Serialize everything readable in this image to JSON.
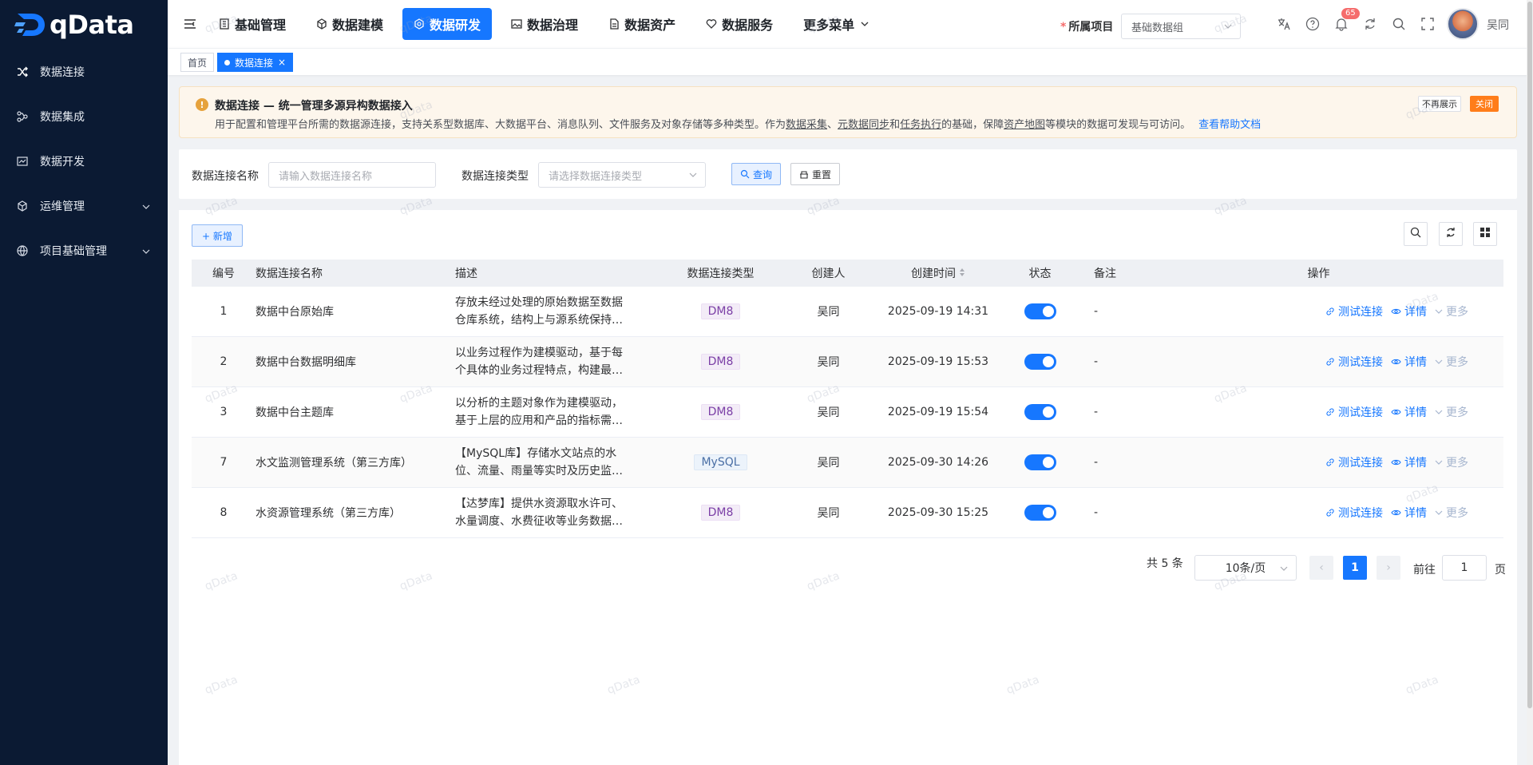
{
  "brand": {
    "name": "qData"
  },
  "sidebar": {
    "items": [
      {
        "label": "数据连接",
        "icon": "shuffle-icon",
        "expandable": false
      },
      {
        "label": "数据集成",
        "icon": "nodes-icon",
        "expandable": false
      },
      {
        "label": "数据开发",
        "icon": "chart-icon",
        "expandable": false
      },
      {
        "label": "运维管理",
        "icon": "cube-icon",
        "expandable": true
      },
      {
        "label": "项目基础管理",
        "icon": "globe-icon",
        "expandable": true
      }
    ]
  },
  "topnav": {
    "items": [
      {
        "label": "基础管理",
        "icon": "building-icon",
        "active": false
      },
      {
        "label": "数据建模",
        "icon": "box-icon",
        "active": false
      },
      {
        "label": "数据研发",
        "icon": "hexagon-icon",
        "active": true
      },
      {
        "label": "数据治理",
        "icon": "image-icon",
        "active": false
      },
      {
        "label": "数据资产",
        "icon": "doc-icon",
        "active": false
      },
      {
        "label": "数据服务",
        "icon": "heart-icon",
        "active": false
      },
      {
        "label": "更多菜单",
        "icon": "chevron-down-icon",
        "active": false
      }
    ],
    "project_label": "所属项目",
    "project_required_mark": "*",
    "project_value": "基础数据组",
    "notification_count": "65",
    "user_name": "吴同"
  },
  "tabs": [
    {
      "label": "首页",
      "active": false
    },
    {
      "label": "数据连接",
      "active": true
    }
  ],
  "notice": {
    "title": "数据连接 — 统一管理多源异构数据接入",
    "desc_part1": "用于配置和管理平台所需的数据源连接，支持关系型数据库、大数据平台、消息队列、文件服务及对象存储等多种类型。作为",
    "link1": "数据采集",
    "sep1": "、",
    "link2": "元数据同步",
    "sep2": "和",
    "link3": "任务执行",
    "desc_part2": "的基础，保障",
    "link4": "资产地图",
    "desc_part3": "等模块的数据可发现与可访问。",
    "help_link": "查看帮助文档",
    "hide_label": "不再展示",
    "close_label": "关闭"
  },
  "search": {
    "name_label": "数据连接名称",
    "name_placeholder": "请输入数据连接名称",
    "type_label": "数据连接类型",
    "type_placeholder": "请选择数据连接类型",
    "query_label": "查询",
    "reset_label": "重置"
  },
  "toolbar": {
    "add_label": "+ 新增"
  },
  "table": {
    "headers": {
      "no": "编号",
      "name": "数据连接名称",
      "desc": "描述",
      "type": "数据连接类型",
      "creator": "创建人",
      "time": "创建时间",
      "status": "状态",
      "note": "备注",
      "ops": "操作"
    },
    "op_test": "测试连接",
    "op_detail": "详情",
    "op_more": "更多",
    "rows": [
      {
        "no": "1",
        "name": "数据中台原始库",
        "desc": "存放未经过处理的原始数据至数据仓库系统，结构上与源系统保持一致",
        "type": "DM8",
        "creator": "吴同",
        "time": "2025-09-19 14:31",
        "enabled": true,
        "note": "-"
      },
      {
        "no": "2",
        "name": "数据中台数据明细库",
        "desc": "以业务过程作为建模驱动，基于每个具体的业务过程特点，构建最细粒度的明细层事实表",
        "type": "DM8",
        "creator": "吴同",
        "time": "2025-09-19 15:53",
        "enabled": true,
        "note": "-"
      },
      {
        "no": "3",
        "name": "数据中台主题库",
        "desc": "以分析的主题对象作为建模驱动，基于上层的应用和产品的指标需求构建公共粒度的汇总指标",
        "type": "DM8",
        "creator": "吴同",
        "time": "2025-09-19 15:54",
        "enabled": true,
        "note": "-"
      },
      {
        "no": "7",
        "name": "水文监测管理系统（第三方库）",
        "desc": "【MySQL库】存储水文站点的水位、流量、雨量等实时及历史监测数据",
        "type": "MySQL",
        "creator": "吴同",
        "time": "2025-09-30 14:26",
        "enabled": true,
        "note": "-"
      },
      {
        "no": "8",
        "name": "水资源管理系统（第三方库）",
        "desc": "【达梦库】提供水资源取水许可、水量调度、水费征收等业务数据支撑",
        "type": "DM8",
        "creator": "吴同",
        "time": "2025-09-30 15:25",
        "enabled": true,
        "note": "-"
      }
    ]
  },
  "pagination": {
    "total_label": "共 5 条",
    "page_size": "10条/页",
    "current_page": "1",
    "goto_label": "前往",
    "goto_value": "1",
    "page_unit": "页"
  },
  "watermark": "qData",
  "colors": {
    "primary": "#1677ff",
    "sidebar_bg": "#0b1a33",
    "notice_bg": "#fdf6ec",
    "close_btn": "#ff7d1a"
  }
}
